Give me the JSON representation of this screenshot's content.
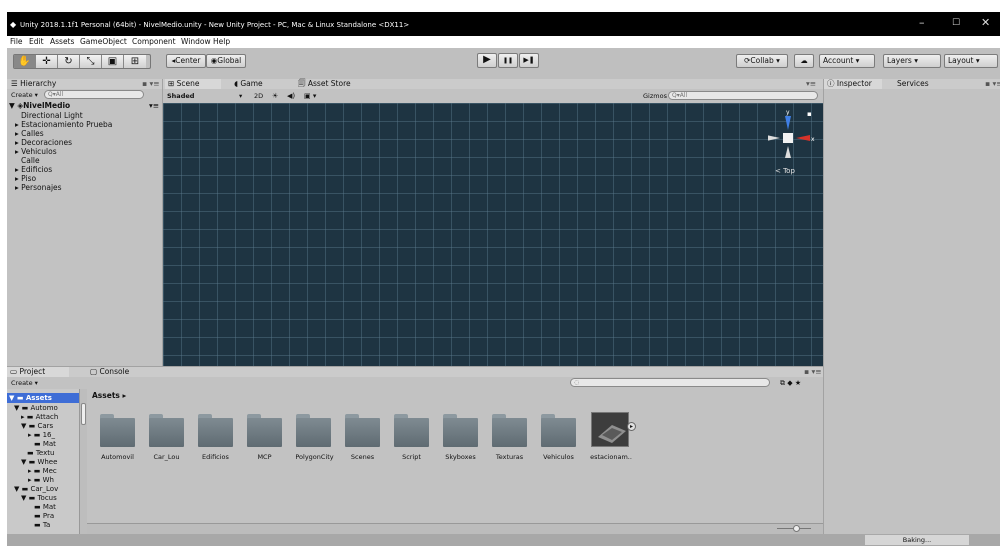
{
  "window": {
    "title": "Unity 2018.1.1f1 Personal (64bit) - NivelMedio.unity - New Unity Project - PC, Mac & Linux Standalone <DX11>",
    "controls": [
      "–",
      "☐",
      "✕"
    ]
  },
  "menu": [
    "File",
    "Edit",
    "Assets",
    "GameObject",
    "Component",
    "Window",
    "Help"
  ],
  "toolbar": {
    "tools": [
      "hand-icon",
      "move-icon",
      "rotate-icon",
      "scale-icon",
      "rect-icon",
      "transform-icon"
    ],
    "center": "Center",
    "global": "Global",
    "play": "▶",
    "pause": "❚❚",
    "step": "▶❚",
    "collab": "Collab ▾",
    "account": "Account",
    "layers": "Layers",
    "layout": "Layout"
  },
  "hierarchy": {
    "tab": "Hierarchy",
    "create": "Create ▾",
    "search": "Q▾All",
    "scene": "NivelMedio",
    "items": [
      "Directional Light",
      "Estacionamiento Prueba",
      "Calles",
      "Decoraciones",
      "Vehiculos",
      "Calle",
      "Edificios",
      "Piso",
      "Personajes"
    ]
  },
  "scene": {
    "tabs": [
      "Scene",
      "Game",
      "Asset Store"
    ],
    "shading": "Shaded",
    "mode2d": "2D",
    "gizmos": "Gizmos ▾",
    "search": "Q▾All",
    "top": "Top"
  },
  "inspector": {
    "tabs": [
      "Inspector",
      "Services"
    ]
  },
  "project": {
    "tabs": [
      "Project",
      "Console"
    ],
    "create": "Create ▾",
    "breadcrumb": "Assets ▸",
    "tree_root": "Assets",
    "tree": [
      "Automo",
      "Attach",
      "Cars",
      "16_",
      "Mat",
      "Textu",
      "Whee",
      "Mec",
      "Wh",
      "Car_Lov",
      "Tocus",
      "Mat",
      "Pra",
      "Ta"
    ],
    "assets": [
      "Automovil",
      "Car_Lou",
      "Edificios",
      "MCP",
      "PolygonCity",
      "Scenes",
      "Script",
      "Skyboxes",
      "Texturas",
      "Vehiculos",
      "estacionam.."
    ]
  },
  "status": {
    "baking": "Baking..."
  },
  "colors": {
    "scene_bg": "#1e3442",
    "panel": "#c2c2c2",
    "titlebar": "#000000"
  }
}
